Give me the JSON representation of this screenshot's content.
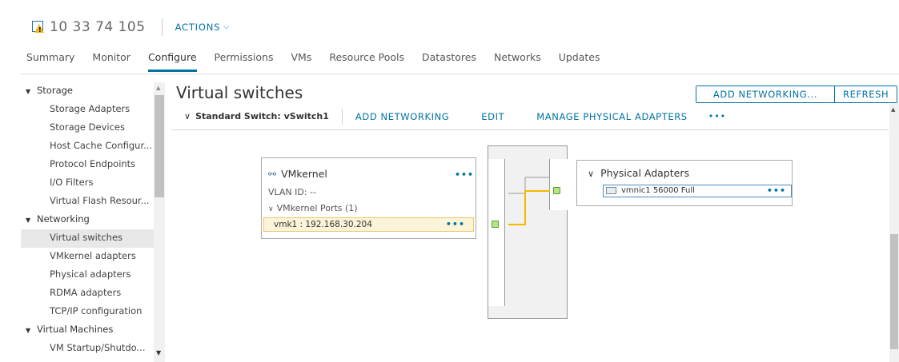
{
  "host": {
    "name": "10 33 74 105",
    "actions_label": "ACTIONS"
  },
  "tabs": [
    {
      "label": "Summary"
    },
    {
      "label": "Monitor"
    },
    {
      "label": "Configure"
    },
    {
      "label": "Permissions"
    },
    {
      "label": "VMs"
    },
    {
      "label": "Resource Pools"
    },
    {
      "label": "Datastores"
    },
    {
      "label": "Networks"
    },
    {
      "label": "Updates"
    }
  ],
  "active_tab": "Configure",
  "sidebar": {
    "groups": [
      {
        "label": "Storage",
        "items": [
          "Storage Adapters",
          "Storage Devices",
          "Host Cache Configur...",
          "Protocol Endpoints",
          "I/O Filters",
          "Virtual Flash Resour..."
        ]
      },
      {
        "label": "Networking",
        "items": [
          "Virtual switches",
          "VMkernel adapters",
          "Physical adapters",
          "RDMA adapters",
          "TCP/IP configuration"
        ]
      },
      {
        "label": "Virtual Machines",
        "items": [
          "VM Startup/Shutdo..."
        ]
      }
    ],
    "selected": "Virtual switches"
  },
  "main": {
    "title": "Virtual switches",
    "buttons": {
      "add_networking": "ADD NETWORKING...",
      "refresh": "REFRESH"
    },
    "switch": {
      "title": "Standard Switch: vSwitch1",
      "links": {
        "add_networking": "ADD NETWORKING",
        "edit": "EDIT",
        "manage_physical_adapters": "MANAGE PHYSICAL ADAPTERS",
        "more": "•••"
      }
    },
    "vmkernel": {
      "title": "VMkernel",
      "vlan": "VLAN ID: --",
      "ports_label": "VMkernel Ports (1)",
      "port": "vmk1 : 192.168.30.204",
      "more": "•••"
    },
    "physical_adapters": {
      "title": "Physical Adapters",
      "adapter": "vmnic1 56000 Full",
      "more": "•••"
    }
  },
  "colors": {
    "accent": "#0072a3",
    "active_path": "#f5b800",
    "port_green": "#b7e38a",
    "warning": "#f0b323"
  }
}
